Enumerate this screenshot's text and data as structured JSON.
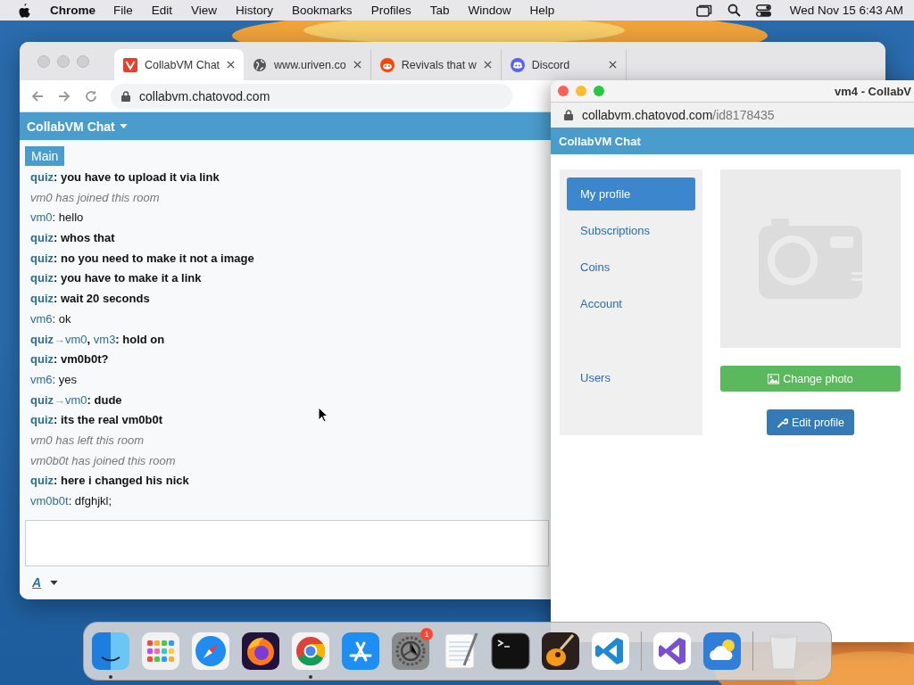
{
  "menu_bar": {
    "app": "Chrome",
    "menus": [
      "File",
      "Edit",
      "View",
      "History",
      "Bookmarks",
      "Profiles",
      "Tab",
      "Window",
      "Help"
    ],
    "clock": "Wed Nov 15  6:43 AM"
  },
  "browser": {
    "tabs": [
      {
        "title": "CollabVM Chat",
        "kind": "collab",
        "selected": true
      },
      {
        "title": "www.uriven.co",
        "kind": "globe",
        "selected": false
      },
      {
        "title": "Revivals that w",
        "kind": "reddit",
        "selected": false
      },
      {
        "title": "Discord",
        "kind": "discord",
        "selected": false
      }
    ],
    "url": "collabvm.chatovod.com"
  },
  "chat": {
    "title": "CollabVM Chat",
    "rooms": [
      {
        "label": "Main",
        "selected": true
      }
    ],
    "messages": [
      {
        "kind": "msg",
        "user": "quiz",
        "text": ": you have to upload it via link",
        "bold": true
      },
      {
        "kind": "system",
        "text": "vm0 has joined this room"
      },
      {
        "kind": "msg",
        "user": "vm0",
        "text": ": hello",
        "bold": false
      },
      {
        "kind": "msg",
        "user": "quiz",
        "text": ": whos that",
        "bold": true
      },
      {
        "kind": "msg",
        "user": "quiz",
        "text": ": no you need to make it not a image",
        "bold": true
      },
      {
        "kind": "msg",
        "user": "quiz",
        "text": ": you have to make it a link",
        "bold": true
      },
      {
        "kind": "msg",
        "user": "quiz",
        "text": ": wait 20 seconds",
        "bold": true
      },
      {
        "kind": "msg",
        "user": "vm6",
        "text": ": ok",
        "bold": false
      },
      {
        "kind": "msg",
        "user": "quiz",
        "arrow": "→",
        "to": [
          "vm0",
          "vm3"
        ],
        "to_sep": ",",
        "text": ": hold on",
        "bold": true
      },
      {
        "kind": "msg",
        "user": "quiz",
        "text": ": vm0b0t?",
        "bold": true
      },
      {
        "kind": "msg",
        "user": "vm6",
        "text": ": yes",
        "bold": false
      },
      {
        "kind": "msg",
        "user": "quiz",
        "arrow": "→",
        "to": [
          "vm0"
        ],
        "text": ": dude",
        "bold": true
      },
      {
        "kind": "msg",
        "user": "quiz",
        "text": ": its the real vm0b0t",
        "bold": true
      },
      {
        "kind": "system",
        "text": "vm0 has left this room"
      },
      {
        "kind": "system",
        "text": "vm0b0t has joined this room"
      },
      {
        "kind": "msg",
        "user": "quiz",
        "text": ": here i changed his nick",
        "bold": true
      },
      {
        "kind": "msg",
        "user": "vm0b0t",
        "text": ": dfghjkl;",
        "bold": false
      }
    ],
    "format_button": "A"
  },
  "popup": {
    "title": "vm4 - CollabV",
    "url_host": "collabvm.chatovod.com",
    "url_path": "/id8178435",
    "header": "CollabVM Chat",
    "nav": [
      {
        "label": "My profile",
        "selected": true
      },
      {
        "label": "Subscriptions",
        "selected": false
      },
      {
        "label": "Coins",
        "selected": false
      },
      {
        "label": "Account",
        "selected": false
      },
      {
        "label": "Users",
        "selected": false
      }
    ],
    "buttons": [
      {
        "label": "Change photo",
        "kind": "photo"
      },
      {
        "label": "Edit profile",
        "kind": "edit"
      }
    ]
  },
  "dock": {
    "apps": [
      {
        "kind": "finder",
        "running": true
      },
      {
        "kind": "launchpad",
        "running": false
      },
      {
        "kind": "safari",
        "running": false
      },
      {
        "kind": "firefox",
        "running": false
      },
      {
        "kind": "chrome",
        "running": true
      },
      {
        "kind": "appstore",
        "running": false
      },
      {
        "kind": "settings",
        "running": false,
        "badge": "1"
      },
      {
        "kind": "textedit",
        "running": false
      },
      {
        "kind": "terminal",
        "running": false
      },
      {
        "kind": "guitar",
        "running": false
      },
      {
        "kind": "vscode",
        "running": false
      },
      {
        "kind": "separator"
      },
      {
        "kind": "vstudio",
        "running": false
      },
      {
        "kind": "weather",
        "running": false
      },
      {
        "kind": "separator"
      },
      {
        "kind": "trash",
        "running": false
      }
    ]
  }
}
